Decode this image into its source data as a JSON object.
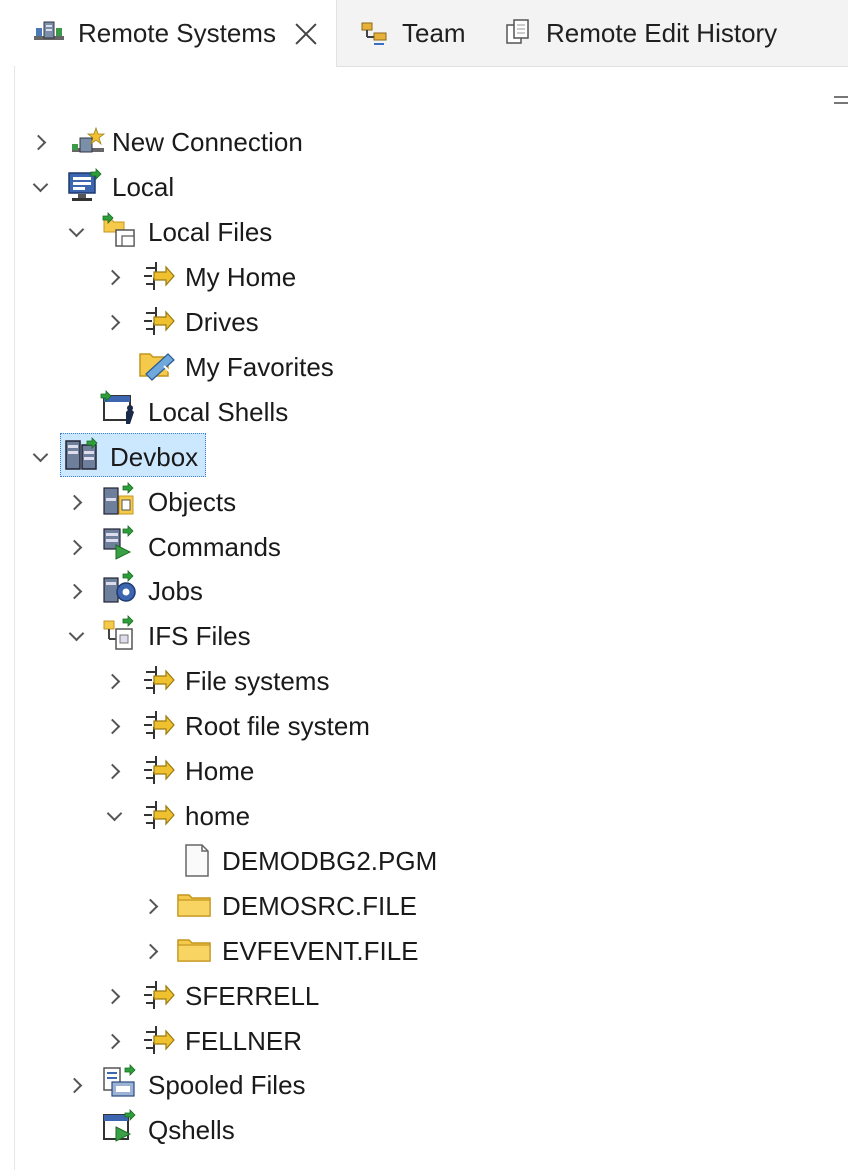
{
  "tabs": [
    {
      "label": "Remote Systems",
      "icon": "remote-systems-icon",
      "active": true
    },
    {
      "label": "Team",
      "icon": "team-icon"
    },
    {
      "label": "Remote Edit History",
      "icon": "remote-edit-history-icon"
    }
  ],
  "tree": {
    "new_connection": "New Connection",
    "local": "Local",
    "local_files": "Local Files",
    "my_home": "My Home",
    "drives": "Drives",
    "my_favorites": "My Favorites",
    "local_shells": "Local Shells",
    "devbox": "Devbox",
    "objects": "Objects",
    "commands": "Commands",
    "jobs": "Jobs",
    "ifs_files": "IFS Files",
    "file_systems": "File systems",
    "root_file_system": "Root file system",
    "home_upper": "Home",
    "home_lower": "home",
    "demodbg2": "DEMODBG2.PGM",
    "demosrc": "DEMOSRC.FILE",
    "evfevent": "EVFEVENT.FILE",
    "sferrell": "SFERRELL",
    "fellner": "FELLNER",
    "spooled_files": "Spooled Files",
    "qshells": "Qshells"
  },
  "colors": {
    "selection": "#cce8ff",
    "folder": "#f2c94c",
    "green_arrow": "#2e9e3a"
  }
}
